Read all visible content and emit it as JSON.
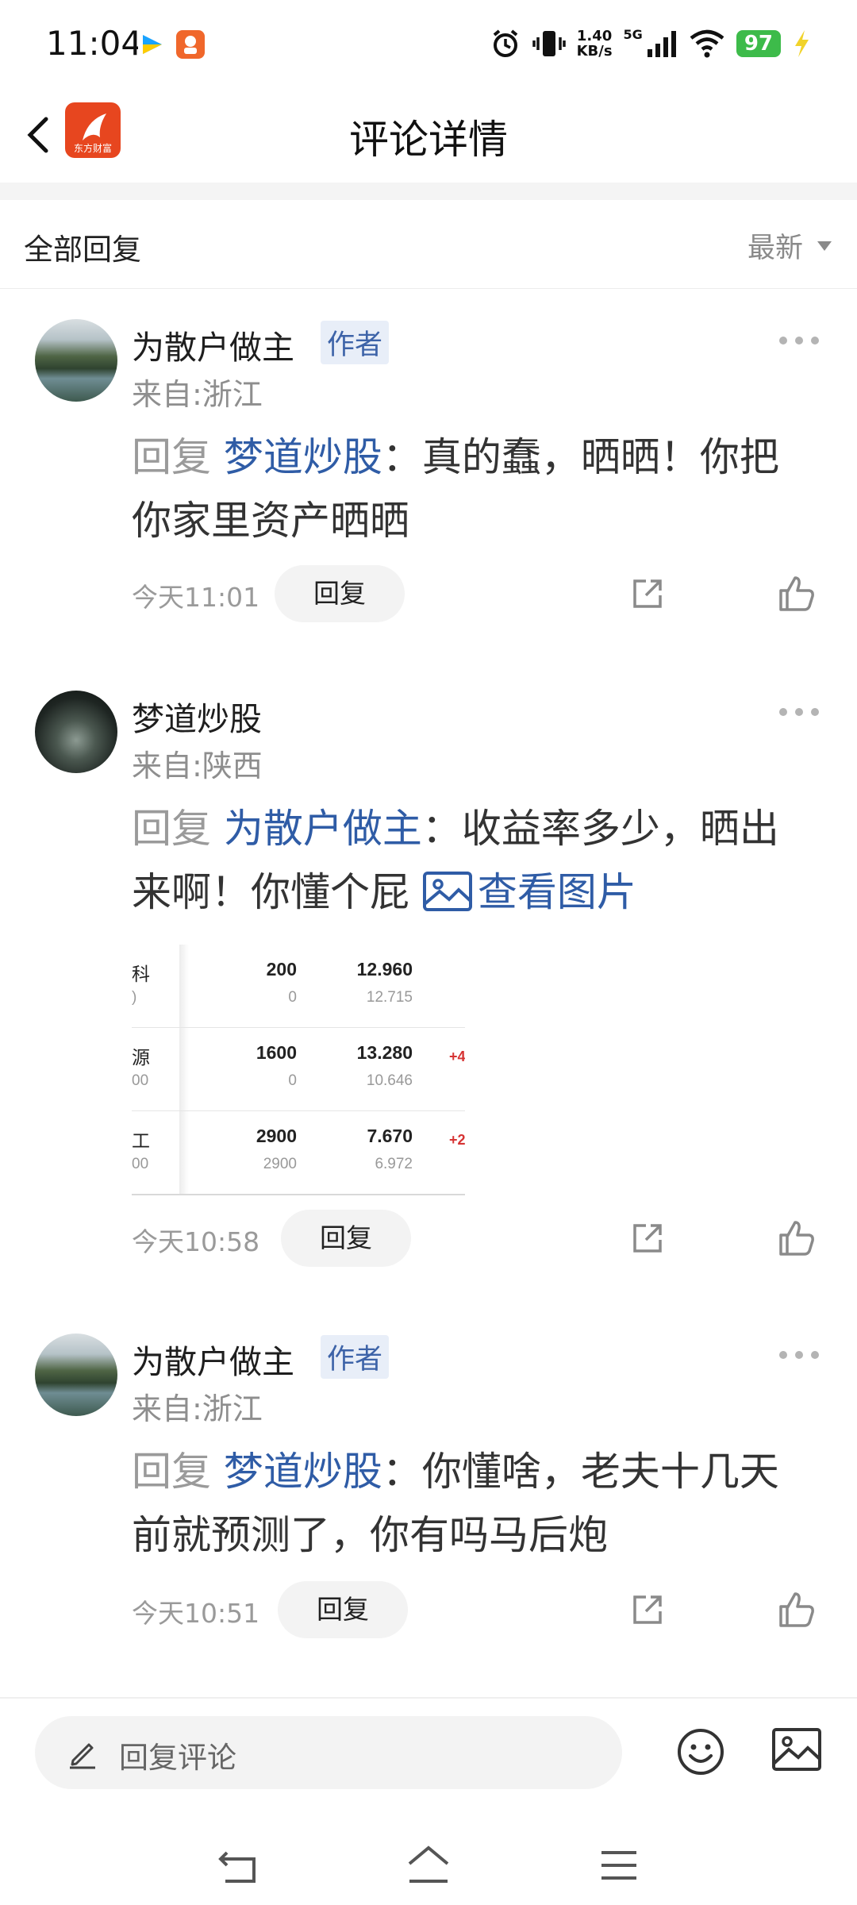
{
  "status_bar": {
    "time": "11:04",
    "net_speed_value": "1.40",
    "net_speed_unit": "KB/s",
    "network": "5G",
    "battery": "97"
  },
  "header": {
    "title": "评论详情",
    "logo_text": "东方财富"
  },
  "filter": {
    "title": "全部回复",
    "sort_label": "最新"
  },
  "comments": [
    {
      "user": "为散户做主",
      "badge": "作者",
      "location": "来自:浙江",
      "reply_prefix": "回复 ",
      "mention": "梦道炒股",
      "text": "：真的蠢，晒晒！你把你家里资产晒晒",
      "time": "今天11:01",
      "reply_label": "回复"
    },
    {
      "user": "梦道炒股",
      "location": "来自:陕西",
      "reply_prefix": "回复 ",
      "mention": "为散户做主",
      "text": "：收益率多少，晒出来啊！你懂个屁 ",
      "view_image": "查看图片",
      "time": "今天10:58",
      "reply_label": "回复"
    },
    {
      "user": "为散户做主",
      "badge": "作者",
      "location": "来自:浙江",
      "reply_prefix": "回复 ",
      "mention": "梦道炒股",
      "text": "：你懂啥，老夫十几天前就预测了，你有吗马后炮",
      "time": "今天10:51",
      "reply_label": "回复"
    }
  ],
  "attached_image": {
    "rows": [
      {
        "name": "科",
        "sub": ")",
        "qty": "200",
        "qty_sub": "0",
        "price": "12.960",
        "price_sub": "12.715",
        "pnl": ""
      },
      {
        "name": "源",
        "sub": "00",
        "qty": "1600",
        "qty_sub": "0",
        "price": "13.280",
        "price_sub": "10.646",
        "pnl": "+4"
      },
      {
        "name": "工",
        "sub": "00",
        "qty": "2900",
        "qty_sub": "2900",
        "price": "7.670",
        "price_sub": "6.972",
        "pnl": "+2"
      }
    ]
  },
  "input_bar": {
    "placeholder": "回复评论"
  },
  "colors": {
    "accent": "#2f5ca6",
    "brand": "#e7461f",
    "battery": "#3dbb4a"
  }
}
